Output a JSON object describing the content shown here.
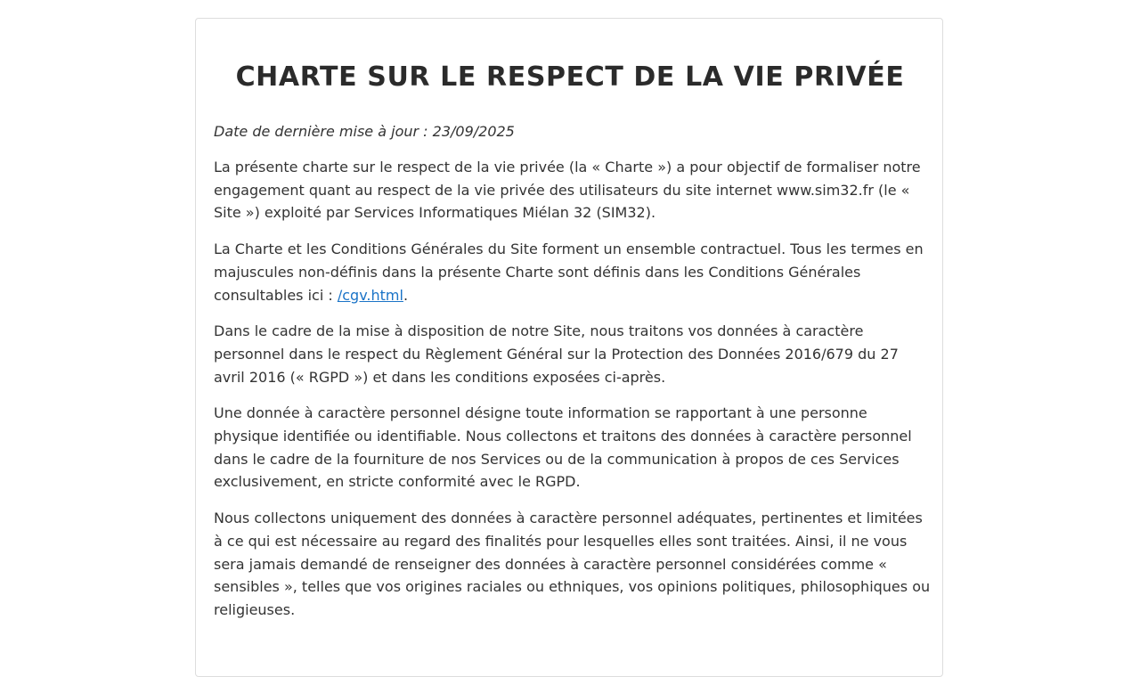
{
  "page": {
    "title": "CHARTE SUR LE RESPECT DE LA VIE PRIVÉE",
    "date_line": "Date de dernière mise à jour : 23/09/2025",
    "paragraphs": {
      "p1": "La présente charte sur le respect de la vie privée (la « Charte ») a pour objectif de formaliser notre engagement quant au respect de la vie privée des utilisateurs du site internet www.sim32.fr (le « Site ») exploité par Services Informatiques Miélan 32 (SIM32).",
      "p2_before": "La Charte et les Conditions Générales du Site forment un ensemble contractuel. Tous les termes en majuscules non-définis dans la présente Charte sont définis dans les Conditions Générales consultables ici : ",
      "p2_link": "/cgv.html",
      "p2_after": ".",
      "p3": "Dans le cadre de la mise à disposition de notre Site, nous traitons vos données à caractère personnel dans le respect du Règlement Général sur la Protection des Données 2016/679 du 27 avril 2016 (« RGPD ») et dans les conditions exposées ci-après.",
      "p4": "Une donnée à caractère personnel désigne toute information se rapportant à une personne physique identifiée ou identifiable. Nous collectons et traitons des données à caractère personnel dans le cadre de la fourniture de nos Services ou de la communication à propos de ces Services exclusivement, en stricte conformité avec le RGPD.",
      "p5": "Nous collectons uniquement des données à caractère personnel adéquates, pertinentes et limitées à ce qui est nécessaire au regard des finalités pour lesquelles elles sont traitées. Ainsi, il ne vous sera jamais demandé de renseigner des données à caractère personnel considérées comme « sensibles », telles que vos origines raciales ou ethniques, vos opinions politiques, philosophiques ou religieuses."
    }
  },
  "colors": {
    "text": "#333333",
    "link": "#1a73c7",
    "border": "#dddddd"
  }
}
